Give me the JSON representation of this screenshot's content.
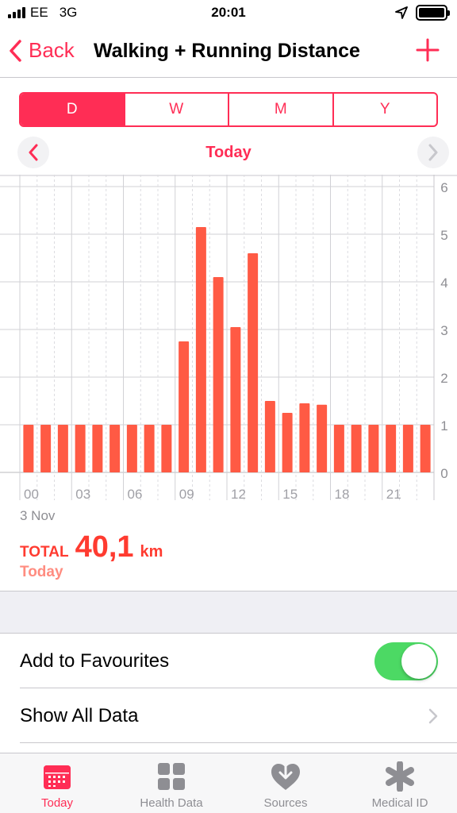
{
  "status_bar": {
    "carrier": "EE",
    "network": "3G",
    "time": "20:01"
  },
  "nav": {
    "back_label": "Back",
    "title": "Walking + Running Distance"
  },
  "segments": [
    {
      "label": "D",
      "active": true
    },
    {
      "label": "W",
      "active": false
    },
    {
      "label": "M",
      "active": false
    },
    {
      "label": "Y",
      "active": false
    }
  ],
  "date_nav": {
    "label": "Today"
  },
  "chart_data": {
    "type": "bar",
    "x": [
      0,
      1,
      2,
      3,
      4,
      5,
      6,
      7,
      8,
      9,
      10,
      11,
      12,
      13,
      14,
      15,
      16,
      17,
      18,
      19,
      20,
      21,
      22,
      23
    ],
    "values": [
      1.0,
      1.0,
      1.0,
      1.0,
      1.0,
      1.0,
      1.0,
      1.0,
      1.0,
      2.75,
      5.15,
      4.1,
      3.05,
      4.6,
      1.5,
      1.25,
      1.45,
      1.42,
      1.0,
      1.0,
      1.0,
      1.0,
      1.0,
      1.0
    ],
    "xtick_labels": [
      "00",
      "03",
      "06",
      "09",
      "12",
      "15",
      "18",
      "21"
    ],
    "ytick_labels": [
      "0",
      "1",
      "2",
      "3",
      "4",
      "5",
      "6"
    ],
    "ylim": [
      0,
      6
    ],
    "grid": true,
    "bar_color": "#ff5a44"
  },
  "chart_date_label": "3 Nov",
  "total": {
    "label": "TOTAL",
    "value": "40,1",
    "unit": "km",
    "period": "Today"
  },
  "rows": {
    "favourites_label": "Add to Favourites",
    "favourites_on": true,
    "show_all_label": "Show All Data"
  },
  "tabs": [
    {
      "label": "Today",
      "icon": "calendar-icon",
      "active": true
    },
    {
      "label": "Health Data",
      "icon": "grid-icon",
      "active": false
    },
    {
      "label": "Sources",
      "icon": "heart-download-icon",
      "active": false
    },
    {
      "label": "Medical ID",
      "icon": "asterisk-icon",
      "active": false
    }
  ],
  "colors": {
    "accent": "#ff2d55",
    "bar": "#ff5a44",
    "toggle_on": "#4cd964"
  }
}
